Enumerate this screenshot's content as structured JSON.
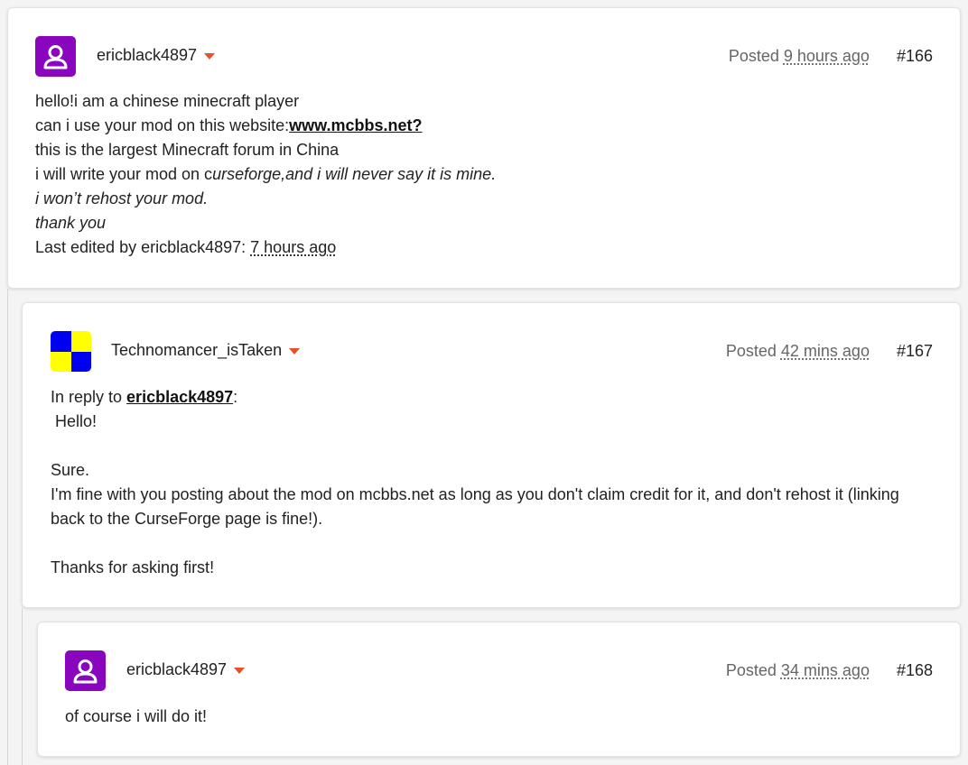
{
  "posts": [
    {
      "username": "ericblack4897",
      "posted_label": "Posted",
      "posted_ago": "9 hours ago",
      "post_number": "#166",
      "line1": "hello!i am a chinese minecraft player",
      "line2_prefix": "can i use your mod on this website:",
      "line2_link": "www.mcbbs.net?",
      "line3": "this is the largest Minecraft forum in China",
      "line4_prefix": "i will write your mod on c",
      "line4_italic": "urseforge,and i will never say it is mine.",
      "line5": "i won’t rehost your mod.",
      "line6": "thank you",
      "edited_prefix": "Last edited by ericblack4897: ",
      "edited_ago": "7 hours ago"
    },
    {
      "username": "Technomancer_isTaken",
      "posted_label": "Posted",
      "posted_ago": "42 mins ago",
      "post_number": "#167",
      "reply_prefix": "In reply to ",
      "reply_user": "ericblack4897",
      "reply_colon": ":",
      "line1": " Hello!",
      "line2": "Sure.",
      "line3": "I'm fine with you posting about the mod on mcbbs.net as long as you don't claim credit for it, and don't rehost it (linking",
      "line4": "back to the CurseForge page is fine!).",
      "line5": "Thanks for asking first!"
    },
    {
      "username": "ericblack4897",
      "posted_label": "Posted",
      "posted_ago": "34 mins ago",
      "post_number": "#168",
      "line1": "of course i will do it!"
    }
  ],
  "colors": {
    "avatar_purple": "#8a05be",
    "checker_blue": "#0000f0",
    "checker_yellow": "#ffff00",
    "caret_orange": "#ea4f2a"
  },
  "icons": {
    "user_avatar": "user-silhouette-icon",
    "dropdown": "caret-down-icon"
  }
}
